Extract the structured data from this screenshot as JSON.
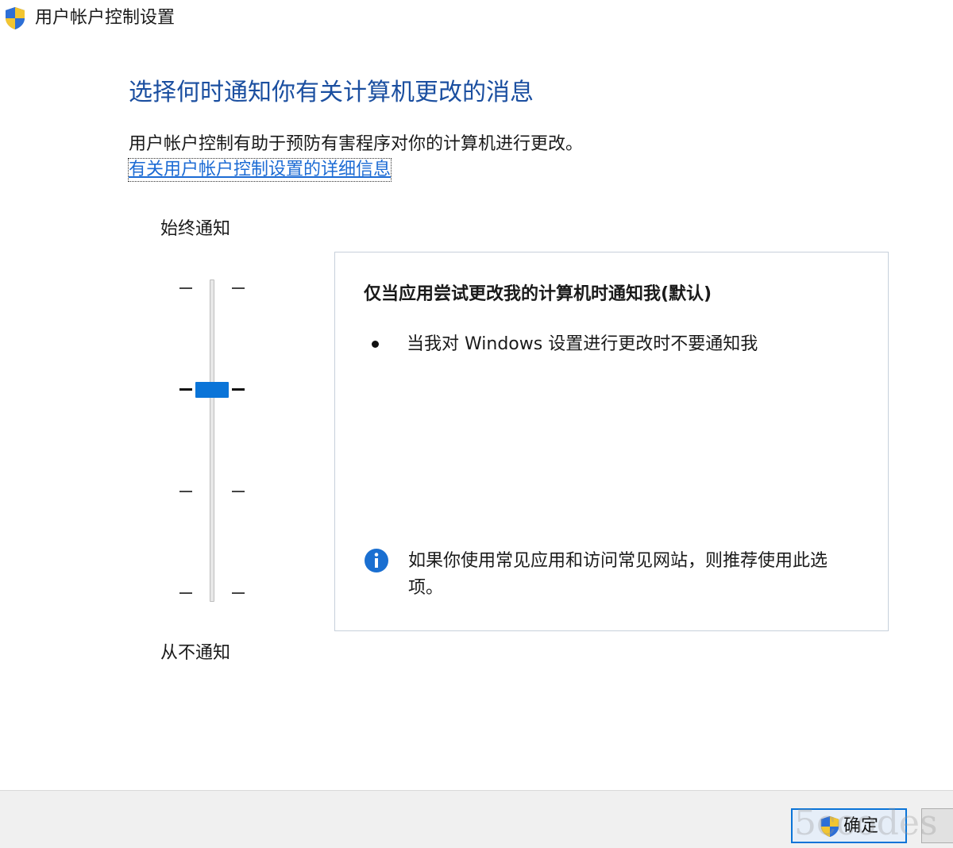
{
  "window": {
    "title": "用户帐户控制设置",
    "icon": "uac-shield-icon"
  },
  "main": {
    "heading": "选择何时通知你有关计算机更改的消息",
    "description": "用户帐户控制有助于预防有害程序对你的计算机进行更改。",
    "link_text": "有关用户帐户控制设置的详细信息"
  },
  "slider": {
    "top_label": "始终通知",
    "bottom_label": "从不通知",
    "levels": 4,
    "selected_level": 2
  },
  "panel": {
    "title": "仅当应用尝试更改我的计算机时通知我(默认)",
    "bullet": "当我对 Windows 设置进行更改时不要通知我",
    "info": "如果你使用常见应用和访问常见网站，则推荐使用此选项。"
  },
  "footer": {
    "ok_label": "确定",
    "cancel_label": ""
  },
  "watermark": "5ccodes",
  "colors": {
    "heading": "#1b4fa0",
    "link": "#1c6bd4",
    "accent": "#0a74d8",
    "info": "#1a6fd1"
  }
}
